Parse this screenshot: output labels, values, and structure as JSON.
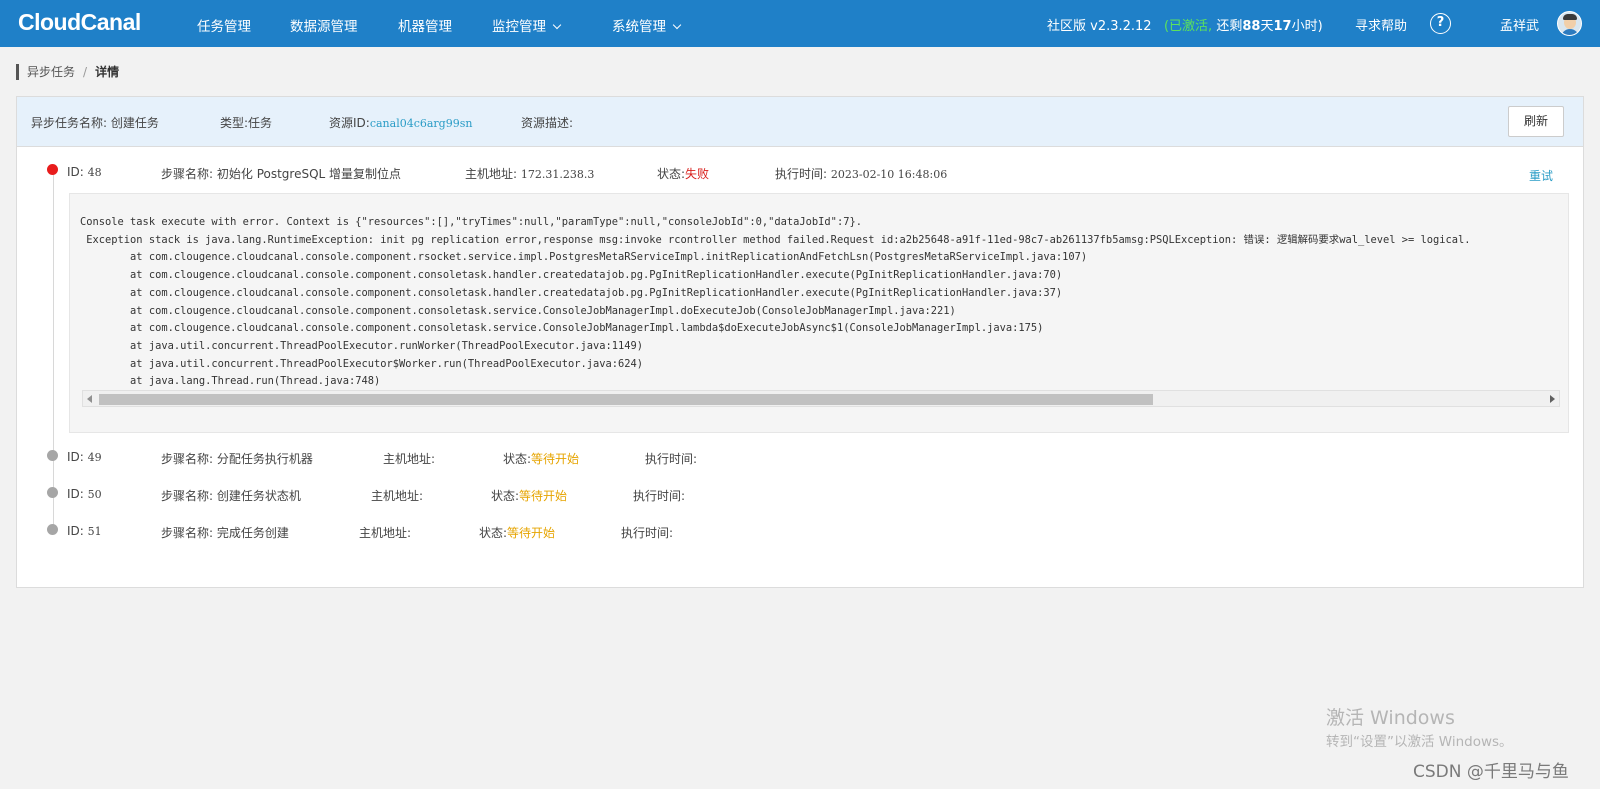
{
  "header": {
    "logo": "CloudCanal",
    "nav": [
      {
        "label": "任务管理",
        "dropdown": false
      },
      {
        "label": "数据源管理",
        "dropdown": false
      },
      {
        "label": "机器管理",
        "dropdown": false
      },
      {
        "label": "监控管理",
        "dropdown": true
      },
      {
        "label": "系统管理",
        "dropdown": true
      }
    ],
    "edition": "社区版 v2.3.2.12",
    "activated": "(已激活,",
    "remain_prefix": "还剩",
    "remain_days": "88",
    "remain_mid": "天",
    "remain_hours": "17",
    "remain_suffix": "小时)",
    "help": "寻求帮助",
    "help_icon": "?",
    "user": "孟祥武",
    "colors": {
      "bar": "#1f80c8",
      "activated": "#5ce25c"
    }
  },
  "breadcrumb": {
    "parent": "异步任务",
    "sep": "/",
    "current": "详情"
  },
  "task": {
    "name_label": "异步任务名称:",
    "name": "创建任务",
    "type_label": "类型:",
    "type": "任务",
    "resource_label": "资源ID:",
    "resource_id": "canal04c6arg99sn",
    "desc_label": "资源描述:",
    "desc": "",
    "refresh": "刷新"
  },
  "steps": [
    {
      "id_label": "ID:",
      "id": "48",
      "name_label": "步骤名称:",
      "name": "初始化 PostgreSQL 增量复制位点",
      "host_label": "主机地址:",
      "host": "172.31.238.3",
      "status_label": "状态:",
      "status": "失败",
      "time_label": "执行时间:",
      "time": "2023-02-10 16:48:06",
      "retry": "重试",
      "state": "failed"
    },
    {
      "id_label": "ID:",
      "id": "49",
      "name_label": "步骤名称:",
      "name": "分配任务执行机器",
      "host_label": "主机地址:",
      "host": "",
      "status_label": "状态:",
      "status": "等待开始",
      "time_label": "执行时间:",
      "time": "",
      "state": "waiting"
    },
    {
      "id_label": "ID:",
      "id": "50",
      "name_label": "步骤名称:",
      "name": "创建任务状态机",
      "host_label": "主机地址:",
      "host": "",
      "status_label": "状态:",
      "status": "等待开始",
      "time_label": "执行时间:",
      "time": "",
      "state": "waiting"
    },
    {
      "id_label": "ID:",
      "id": "51",
      "name_label": "步骤名称:",
      "name": "完成任务创建",
      "host_label": "主机地址:",
      "host": "",
      "status_label": "状态:",
      "status": "等待开始",
      "time_label": "执行时间:",
      "time": "",
      "state": "waiting"
    }
  ],
  "log_lines": [
    "Console task execute with error. Context is {\"resources\":[],\"tryTimes\":null,\"paramType\":null,\"consoleJobId\":0,\"dataJobId\":7}.",
    " Exception stack is java.lang.RuntimeException: init pg replication error,response msg:invoke rcontroller method failed.Request id:a2b25648-a91f-11ed-98c7-ab261137fb5amsg:PSQLException: 错误: 逻辑解码要求wal_level >= logical.",
    "\tat com.clougence.cloudcanal.console.component.rsocket.service.impl.PostgresMetaRServiceImpl.initReplicationAndFetchLsn(PostgresMetaRServiceImpl.java:107)",
    "\tat com.clougence.cloudcanal.console.component.consoletask.handler.createdatajob.pg.PgInitReplicationHandler.execute(PgInitReplicationHandler.java:70)",
    "\tat com.clougence.cloudcanal.console.component.consoletask.handler.createdatajob.pg.PgInitReplicationHandler.execute(PgInitReplicationHandler.java:37)",
    "\tat com.clougence.cloudcanal.console.component.consoletask.service.ConsoleJobManagerImpl.doExecuteJob(ConsoleJobManagerImpl.java:221)",
    "\tat com.clougence.cloudcanal.console.component.consoletask.service.ConsoleJobManagerImpl.lambda$doExecuteJobAsync$1(ConsoleJobManagerImpl.java:175)",
    "\tat java.util.concurrent.ThreadPoolExecutor.runWorker(ThreadPoolExecutor.java:1149)",
    "\tat java.util.concurrent.ThreadPoolExecutor$Worker.run(ThreadPoolExecutor.java:624)",
    "\tat java.lang.Thread.run(Thread.java:748)"
  ],
  "log_scroll_fraction": 0.73,
  "watermark": {
    "title": "激活 Windows",
    "subtitle": "转到“设置”以激活 Windows。",
    "csdn": "CSDN @千里马与鱼"
  }
}
